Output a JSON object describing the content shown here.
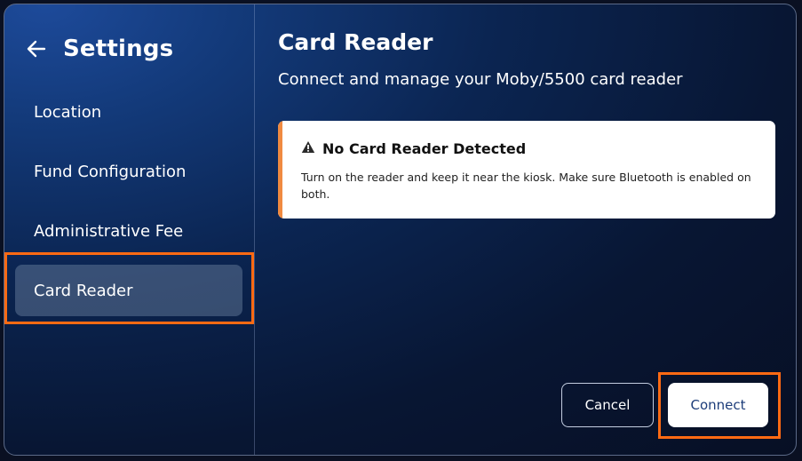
{
  "sidebar": {
    "title": "Settings",
    "back_icon": "arrow-left-icon",
    "items": [
      {
        "label": "Location",
        "active": false
      },
      {
        "label": "Fund Configuration",
        "active": false
      },
      {
        "label": "Administrative Fee",
        "active": false
      },
      {
        "label": "Card Reader",
        "active": true
      }
    ]
  },
  "main": {
    "title": "Card Reader",
    "subtitle": "Connect and manage your Moby/5500 card reader",
    "alert": {
      "icon": "warning-icon",
      "title": "No Card Reader Detected",
      "message": "Turn on the reader and keep it near the kiosk. Make sure Bluetooth is enabled on both.",
      "accent_color": "#f08a40"
    },
    "buttons": {
      "cancel_label": "Cancel",
      "connect_label": "Connect"
    }
  },
  "colors": {
    "highlight": "#ff6a13",
    "active_item_bg": "#4a5d7e",
    "connect_text": "#1d3d7a"
  }
}
